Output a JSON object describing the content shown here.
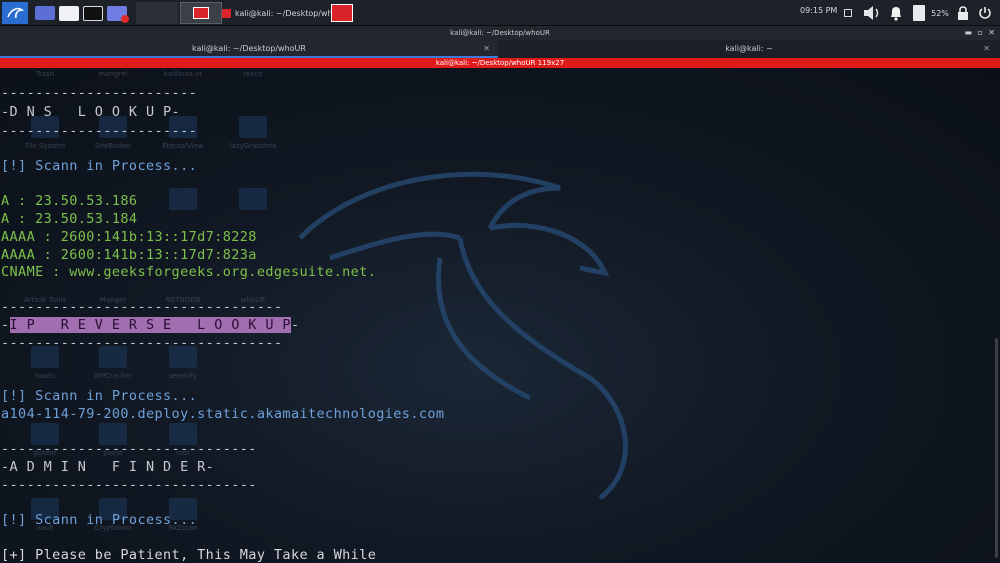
{
  "panel": {
    "clock": "09:15 PM",
    "battery": "52%",
    "task_label": "kali@kali: ~/Desktop/wh...",
    "icons": [
      "kali-dragon-icon",
      "workspace-icon",
      "file-manager-icon",
      "terminal-icon",
      "screen-recorder-icon"
    ]
  },
  "window": {
    "title": "kali@kali: ~/Desktop/whoUR",
    "tabs": [
      {
        "label": "kali@kali: ~/Desktop/whoUR",
        "active": true
      },
      {
        "label": "kali@kali: ~",
        "active": false
      }
    ],
    "terminal_title": "kali@kali: ~/Desktop/whoUR 119x27"
  },
  "desktop_icons": [
    "Trash",
    "mangrel",
    "kalilinux.vt",
    "rexce",
    "File System",
    "SiteBroker",
    "EternalView",
    "lazyGrandma",
    "Article Tools",
    "Manger",
    "NETNOOB",
    "whoUR",
    "nuatu",
    "WPCracker",
    "serenity",
    "gutenr",
    "paest",
    "root",
    "vault",
    "Cryptoloto",
    "PAZscan"
  ],
  "terminal": {
    "dns_rule": "-----------------------",
    "dns_title": "-D N S   L O O K U P-",
    "scan1": "[!] Scann in Process...",
    "records": [
      "A : 23.50.53.186",
      "A : 23.50.53.184",
      "AAAA : 2600:141b:13::17d7:8228",
      "AAAA : 2600:141b:13::17d7:823a",
      "CNAME : www.geeksforgeeks.org.edgesuite.net."
    ],
    "ip_rule": "---------------------------------",
    "ip_title": "I P   R E V E R S E   L O O K U P",
    "ip_lead": "-",
    "ip_tail": "-",
    "scan2": "[!] Scann in Process...",
    "reverse_host": "a104-114-79-200.deploy.static.akamaitechnologies.com",
    "admin_rule": "------------------------------",
    "admin_title": "-A D M I N   F I N D E R-",
    "scan3": "[!] Scann in Process...",
    "patience": "[+] Please be Patient, This May Take a While"
  },
  "colors": {
    "accent_red": "#e01b1b",
    "terminal_green": "#7dc14a",
    "terminal_blue": "#6fa0d8",
    "highlight_purple": "#a16fb0"
  }
}
